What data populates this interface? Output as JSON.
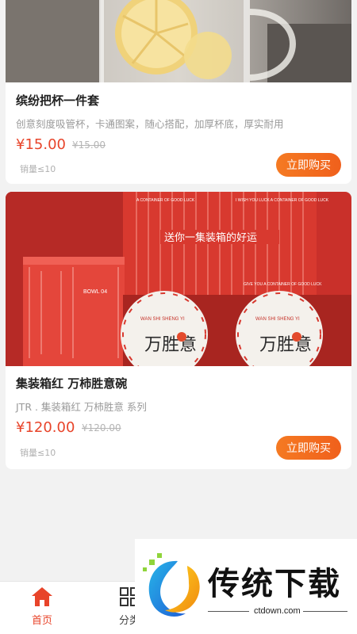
{
  "products": [
    {
      "title": "缤纷把杯一件套",
      "description": "创意刻度吸管杯，卡通图案，随心搭配，加厚杯底，厚实耐用",
      "price": "¥15.00",
      "original_price": "¥15.00",
      "sales": "销量≤10",
      "buy_label": "立即购买"
    },
    {
      "title": "集装箱红 万柿胜意碗",
      "description": "JTR . 集装箱红 万柿胜意 系列",
      "price": "¥120.00",
      "original_price": "¥120.00",
      "sales": "销量≤10",
      "buy_label": "立即购买"
    }
  ],
  "product_image": {
    "banner_text": "送你一集装箱的好运",
    "box_text_left": "A CONTAINER OF GOOD LUCK",
    "box_text_right": "I WISH YOU LUCK A CONTAINER OF GOOD LUCK",
    "box_text_bottom": "GIVE YOU A CONTAINER OF GOOD LUCK",
    "bowl_label": "BOWL 04",
    "plate_pinyin": "WAN SHI SHENG YI",
    "plate_chars": "万胜意"
  },
  "tabbar": {
    "tabs": [
      {
        "label": "首页",
        "icon": "home-icon",
        "active": true
      },
      {
        "label": "分类",
        "icon": "category-grid-icon",
        "active": false
      }
    ]
  },
  "watermark": {
    "text": "传统下载",
    "domain": "ctdown.com"
  },
  "colors": {
    "accent": "#e8442a",
    "button": "#f2691f",
    "container_red": "#d8392f"
  }
}
